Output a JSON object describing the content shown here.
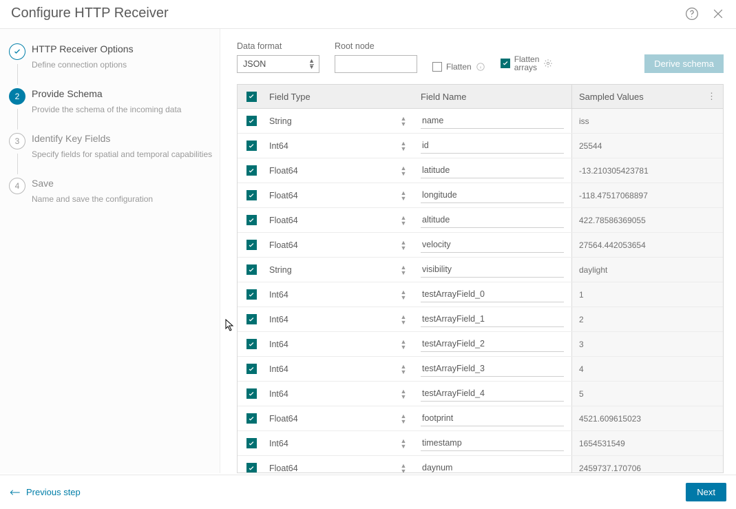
{
  "header": {
    "title": "Configure HTTP Receiver"
  },
  "sidebar": {
    "steps": [
      {
        "title": "HTTP Receiver Options",
        "desc": "Define connection options",
        "state": "done"
      },
      {
        "title": "Provide Schema",
        "desc": "Provide the schema of the incoming data",
        "state": "current"
      },
      {
        "title": "Identify Key Fields",
        "desc": "Specify fields for spatial and temporal capabilities",
        "state": "future",
        "num": "3"
      },
      {
        "title": "Save",
        "desc": "Name and save the configuration",
        "state": "future",
        "num": "4"
      }
    ]
  },
  "controls": {
    "data_format_label": "Data format",
    "data_format_value": "JSON",
    "root_node_label": "Root node",
    "root_node_value": "",
    "flatten_label": "Flatten",
    "flatten_checked": false,
    "flatten_arrays_label_line1": "Flatten",
    "flatten_arrays_label_line2": "arrays",
    "flatten_arrays_checked": true,
    "derive_label": "Derive schema"
  },
  "table": {
    "head": {
      "type": "Field Type",
      "name": "Field Name",
      "val": "Sampled Values"
    },
    "rows": [
      {
        "type": "String",
        "name": "name",
        "val": "iss"
      },
      {
        "type": "Int64",
        "name": "id",
        "val": "25544"
      },
      {
        "type": "Float64",
        "name": "latitude",
        "val": "-13.210305423781"
      },
      {
        "type": "Float64",
        "name": "longitude",
        "val": "-118.47517068897"
      },
      {
        "type": "Float64",
        "name": "altitude",
        "val": "422.78586369055"
      },
      {
        "type": "Float64",
        "name": "velocity",
        "val": "27564.442053654"
      },
      {
        "type": "String",
        "name": "visibility",
        "val": "daylight"
      },
      {
        "type": "Int64",
        "name": "testArrayField_0",
        "val": "1"
      },
      {
        "type": "Int64",
        "name": "testArrayField_1",
        "val": "2"
      },
      {
        "type": "Int64",
        "name": "testArrayField_2",
        "val": "3"
      },
      {
        "type": "Int64",
        "name": "testArrayField_3",
        "val": "4"
      },
      {
        "type": "Int64",
        "name": "testArrayField_4",
        "val": "5"
      },
      {
        "type": "Float64",
        "name": "footprint",
        "val": "4521.609615023"
      },
      {
        "type": "Int64",
        "name": "timestamp",
        "val": "1654531549"
      },
      {
        "type": "Float64",
        "name": "daynum",
        "val": "2459737.170706"
      }
    ]
  },
  "footer": {
    "previous": "Previous step",
    "next": "Next"
  }
}
